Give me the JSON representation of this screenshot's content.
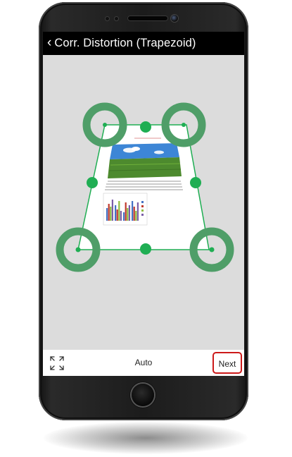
{
  "app": {
    "title": "Corr. Distortion (Trapezoid)",
    "back_icon": "chevron-left-icon"
  },
  "toolbar": {
    "fit_icon": "expand-arrows-icon",
    "auto_label": "Auto",
    "next_label": "Next"
  },
  "colors": {
    "accent_green": "#1fae53",
    "handle_ring_green": "#4f9e68",
    "next_border_red": "#cc1a1a",
    "screen_gray": "#dcdcdc"
  },
  "chart_thumbnail": {
    "series_colors": [
      "#4472c4",
      "#c0392b",
      "#8fbc3f",
      "#7b5ea7"
    ]
  }
}
